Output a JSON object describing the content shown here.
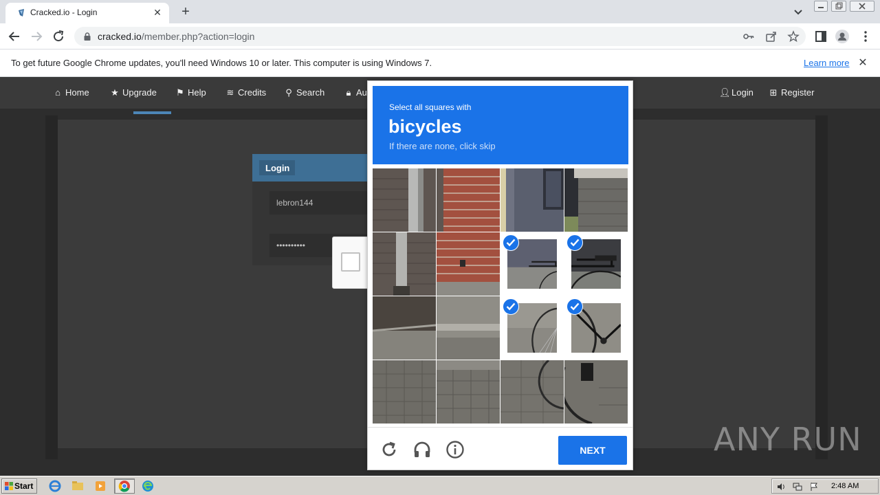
{
  "browser": {
    "tab_title": "Cracked.io - Login",
    "url_host": "cracked.io",
    "url_path": "/member.php?action=login"
  },
  "infobar": {
    "message": "To get future Google Chrome updates, you'll need Windows 10 or later. This computer is using Windows 7.",
    "learn_more": "Learn more"
  },
  "site": {
    "nav": {
      "home": "Home",
      "upgrade": "Upgrade",
      "help": "Help",
      "credits": "Credits",
      "search": "Search",
      "auth": "Au",
      "login": "Login",
      "register": "Register"
    },
    "login_panel": {
      "title": "Login",
      "username_value": "lebron144",
      "password_value": "••••••••••"
    }
  },
  "captcha": {
    "instruction": "Select all squares with",
    "target": "bicycles",
    "hint": "If there are none, click skip",
    "next_label": "NEXT",
    "selected_tiles": [
      6,
      7,
      10,
      11
    ],
    "accent": "#1a73e8"
  },
  "watermark": {
    "text": "ANY RUN"
  },
  "taskbar": {
    "start_label": "Start",
    "clock": "2:48 AM"
  }
}
